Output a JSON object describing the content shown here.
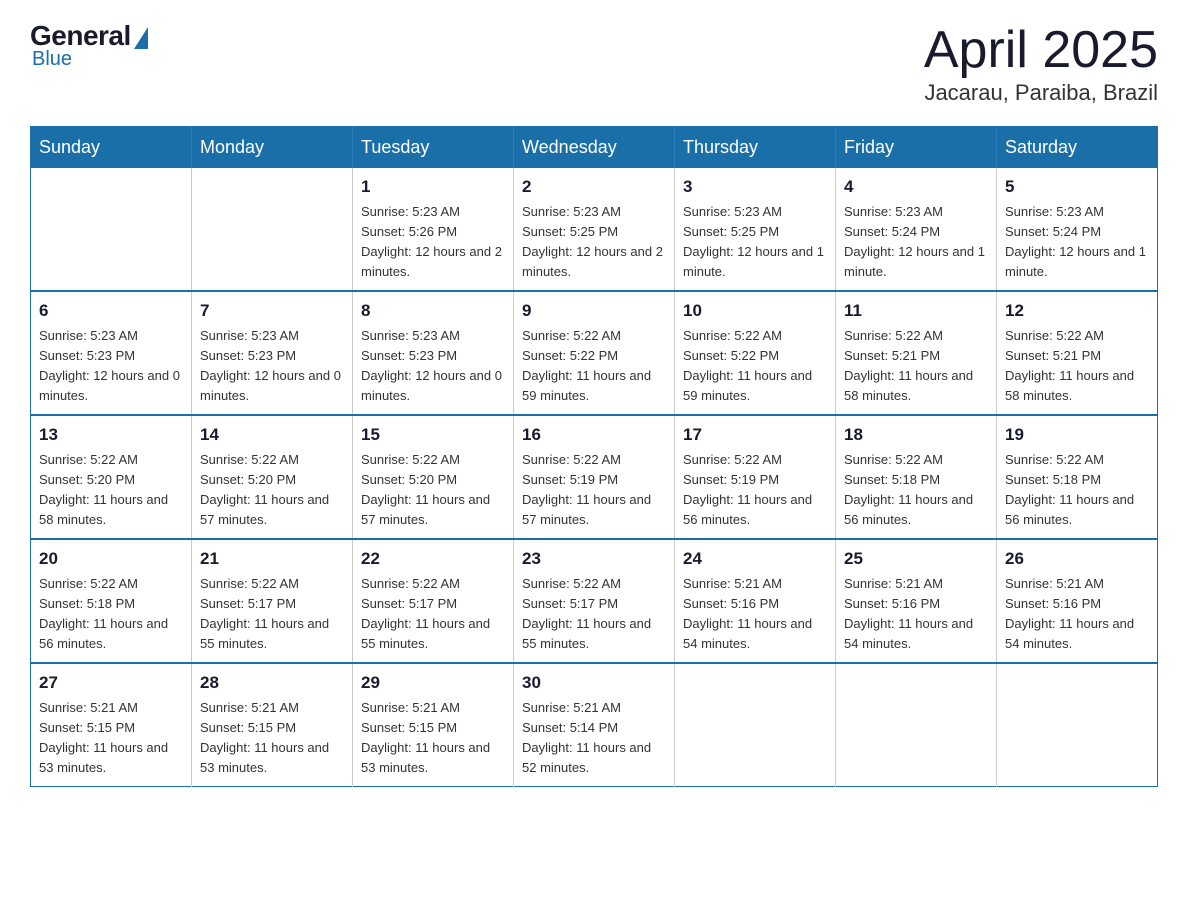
{
  "logo": {
    "general": "General",
    "blue": "Blue"
  },
  "title": {
    "month": "April 2025",
    "location": "Jacarau, Paraiba, Brazil"
  },
  "weekdays": [
    "Sunday",
    "Monday",
    "Tuesday",
    "Wednesday",
    "Thursday",
    "Friday",
    "Saturday"
  ],
  "weeks": [
    [
      {
        "day": "",
        "info": ""
      },
      {
        "day": "",
        "info": ""
      },
      {
        "day": "1",
        "info": "Sunrise: 5:23 AM\nSunset: 5:26 PM\nDaylight: 12 hours and 2 minutes."
      },
      {
        "day": "2",
        "info": "Sunrise: 5:23 AM\nSunset: 5:25 PM\nDaylight: 12 hours and 2 minutes."
      },
      {
        "day": "3",
        "info": "Sunrise: 5:23 AM\nSunset: 5:25 PM\nDaylight: 12 hours and 1 minute."
      },
      {
        "day": "4",
        "info": "Sunrise: 5:23 AM\nSunset: 5:24 PM\nDaylight: 12 hours and 1 minute."
      },
      {
        "day": "5",
        "info": "Sunrise: 5:23 AM\nSunset: 5:24 PM\nDaylight: 12 hours and 1 minute."
      }
    ],
    [
      {
        "day": "6",
        "info": "Sunrise: 5:23 AM\nSunset: 5:23 PM\nDaylight: 12 hours and 0 minutes."
      },
      {
        "day": "7",
        "info": "Sunrise: 5:23 AM\nSunset: 5:23 PM\nDaylight: 12 hours and 0 minutes."
      },
      {
        "day": "8",
        "info": "Sunrise: 5:23 AM\nSunset: 5:23 PM\nDaylight: 12 hours and 0 minutes."
      },
      {
        "day": "9",
        "info": "Sunrise: 5:22 AM\nSunset: 5:22 PM\nDaylight: 11 hours and 59 minutes."
      },
      {
        "day": "10",
        "info": "Sunrise: 5:22 AM\nSunset: 5:22 PM\nDaylight: 11 hours and 59 minutes."
      },
      {
        "day": "11",
        "info": "Sunrise: 5:22 AM\nSunset: 5:21 PM\nDaylight: 11 hours and 58 minutes."
      },
      {
        "day": "12",
        "info": "Sunrise: 5:22 AM\nSunset: 5:21 PM\nDaylight: 11 hours and 58 minutes."
      }
    ],
    [
      {
        "day": "13",
        "info": "Sunrise: 5:22 AM\nSunset: 5:20 PM\nDaylight: 11 hours and 58 minutes."
      },
      {
        "day": "14",
        "info": "Sunrise: 5:22 AM\nSunset: 5:20 PM\nDaylight: 11 hours and 57 minutes."
      },
      {
        "day": "15",
        "info": "Sunrise: 5:22 AM\nSunset: 5:20 PM\nDaylight: 11 hours and 57 minutes."
      },
      {
        "day": "16",
        "info": "Sunrise: 5:22 AM\nSunset: 5:19 PM\nDaylight: 11 hours and 57 minutes."
      },
      {
        "day": "17",
        "info": "Sunrise: 5:22 AM\nSunset: 5:19 PM\nDaylight: 11 hours and 56 minutes."
      },
      {
        "day": "18",
        "info": "Sunrise: 5:22 AM\nSunset: 5:18 PM\nDaylight: 11 hours and 56 minutes."
      },
      {
        "day": "19",
        "info": "Sunrise: 5:22 AM\nSunset: 5:18 PM\nDaylight: 11 hours and 56 minutes."
      }
    ],
    [
      {
        "day": "20",
        "info": "Sunrise: 5:22 AM\nSunset: 5:18 PM\nDaylight: 11 hours and 56 minutes."
      },
      {
        "day": "21",
        "info": "Sunrise: 5:22 AM\nSunset: 5:17 PM\nDaylight: 11 hours and 55 minutes."
      },
      {
        "day": "22",
        "info": "Sunrise: 5:22 AM\nSunset: 5:17 PM\nDaylight: 11 hours and 55 minutes."
      },
      {
        "day": "23",
        "info": "Sunrise: 5:22 AM\nSunset: 5:17 PM\nDaylight: 11 hours and 55 minutes."
      },
      {
        "day": "24",
        "info": "Sunrise: 5:21 AM\nSunset: 5:16 PM\nDaylight: 11 hours and 54 minutes."
      },
      {
        "day": "25",
        "info": "Sunrise: 5:21 AM\nSunset: 5:16 PM\nDaylight: 11 hours and 54 minutes."
      },
      {
        "day": "26",
        "info": "Sunrise: 5:21 AM\nSunset: 5:16 PM\nDaylight: 11 hours and 54 minutes."
      }
    ],
    [
      {
        "day": "27",
        "info": "Sunrise: 5:21 AM\nSunset: 5:15 PM\nDaylight: 11 hours and 53 minutes."
      },
      {
        "day": "28",
        "info": "Sunrise: 5:21 AM\nSunset: 5:15 PM\nDaylight: 11 hours and 53 minutes."
      },
      {
        "day": "29",
        "info": "Sunrise: 5:21 AM\nSunset: 5:15 PM\nDaylight: 11 hours and 53 minutes."
      },
      {
        "day": "30",
        "info": "Sunrise: 5:21 AM\nSunset: 5:14 PM\nDaylight: 11 hours and 52 minutes."
      },
      {
        "day": "",
        "info": ""
      },
      {
        "day": "",
        "info": ""
      },
      {
        "day": "",
        "info": ""
      }
    ]
  ]
}
